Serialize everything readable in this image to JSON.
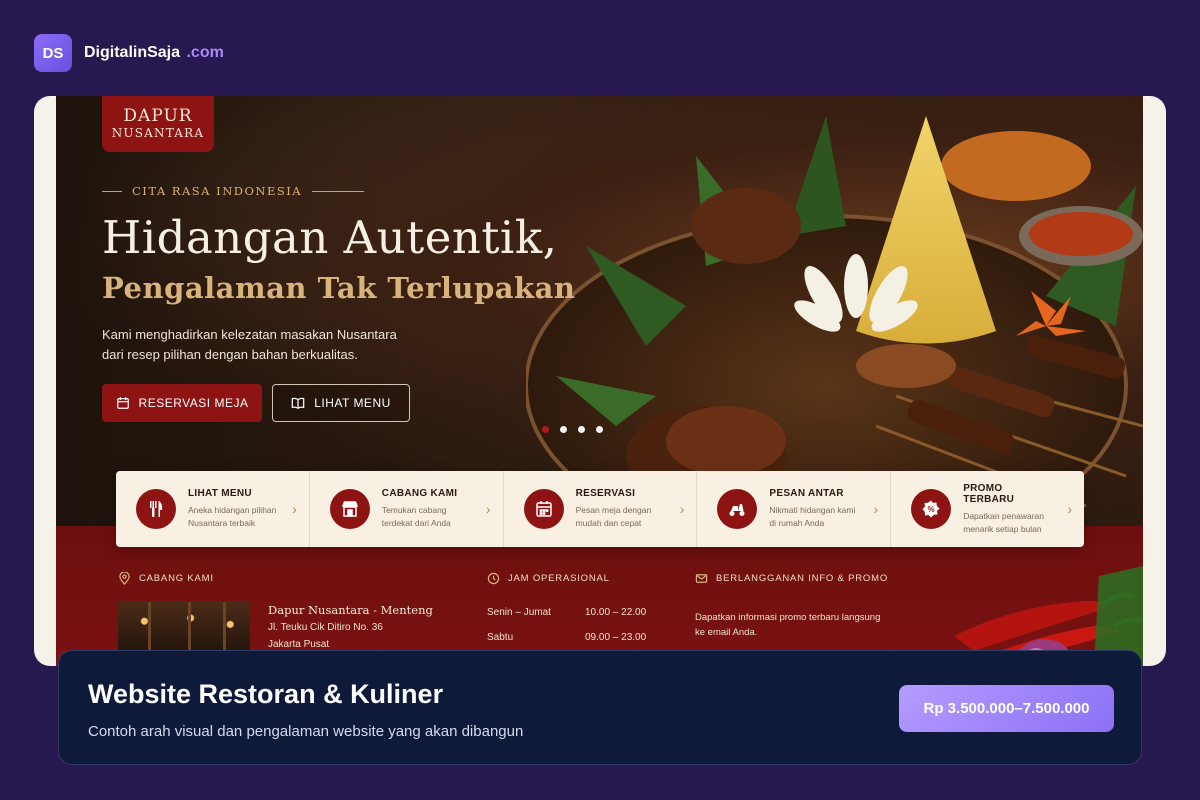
{
  "brand": {
    "logo": "DS",
    "name": "DigitalinSaja",
    "tld": ".com"
  },
  "site": {
    "logo_line1": "DAPUR",
    "logo_line2": "NUSANTARA",
    "eyebrow": "CITA RASA INDONESIA",
    "title": "Hidangan Autentik,",
    "subtitle": "Pengalaman Tak Terlupakan",
    "description": "Kami menghadirkan kelezatan masakan Nusantara dari resep pilihan dengan bahan berkualitas.",
    "btn_reserve": "RESERVASI MEJA",
    "btn_menu": "LIHAT MENU",
    "slider": {
      "count": 4,
      "active": 1
    },
    "features": [
      {
        "title": "LIHAT MENU",
        "desc": "Aneka hidangan pilihan Nusantara terbaik",
        "icon": "utensils-icon"
      },
      {
        "title": "CABANG KAMI",
        "desc": "Temukan cabang terdekat dari Anda",
        "icon": "store-icon"
      },
      {
        "title": "RESERVASI",
        "desc": "Pesan meja dengan mudah dan cepat",
        "icon": "calendar-icon"
      },
      {
        "title": "PESAN ANTAR",
        "desc": "Nikmati hidangan kami di rumah Anda",
        "icon": "scooter-icon"
      },
      {
        "title": "PROMO TERBARU",
        "desc": "Dapatkan penawaran menarik setiap bulan",
        "icon": "discount-icon"
      }
    ],
    "branches": {
      "heading": "CABANG KAMI",
      "name": "Dapur Nusantara - Menteng",
      "address1": "Jl. Teuku Cik Ditiro No. 36",
      "address2": "Jakarta Pusat"
    },
    "hours": {
      "heading": "JAM OPERASIONAL",
      "rows": [
        {
          "day": "Senin – Jumat",
          "time": "10.00  –  22.00"
        },
        {
          "day": "Sabtu",
          "time": "09.00  –  23.00"
        }
      ]
    },
    "newsletter": {
      "heading": "BERLANGGANAN INFO & PROMO",
      "text": "Dapatkan informasi promo terbaru langsung ke email Anda."
    }
  },
  "banner": {
    "title": "Website Restoran & Kuliner",
    "subtitle": "Contoh arah visual dan pengalaman website yang akan dibangun",
    "price": "Rp 3.500.000–7.500.000"
  },
  "colors": {
    "accent": "#8e1414",
    "gold": "#d8b47c",
    "bg": "#27184f",
    "banner": "#0f1a3a",
    "price": "#a78bfa"
  }
}
